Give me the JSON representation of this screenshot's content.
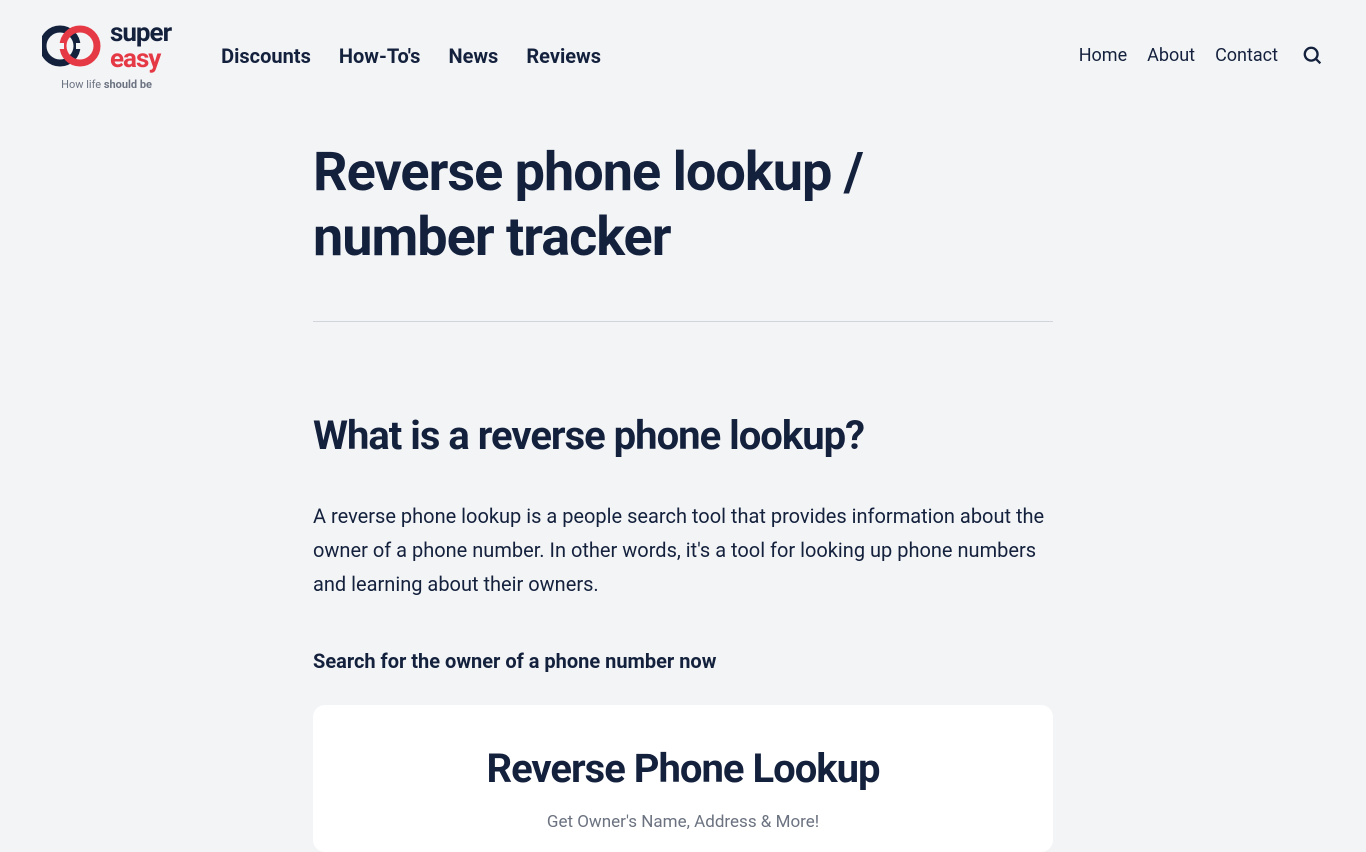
{
  "logo": {
    "text_top": "super",
    "text_bottom": "easy",
    "tagline_prefix": "How life ",
    "tagline_strong": "should be"
  },
  "nav": {
    "primary": [
      {
        "label": "Discounts"
      },
      {
        "label": "How-To's"
      },
      {
        "label": "News"
      },
      {
        "label": "Reviews"
      }
    ],
    "secondary": [
      {
        "label": "Home"
      },
      {
        "label": "About"
      },
      {
        "label": "Contact"
      }
    ]
  },
  "main": {
    "title": "Reverse phone lookup / number tracker",
    "section_heading": "What is a reverse phone lookup?",
    "body_text": "A reverse phone lookup is a people search tool that provides information about the owner of a phone number. In other words, it's a tool for looking up phone numbers and learning about their owners.",
    "subheading": "Search for the owner of a phone number now",
    "card": {
      "title": "Reverse Phone Lookup",
      "subtitle": "Get Owner's Name, Address & More!"
    }
  }
}
